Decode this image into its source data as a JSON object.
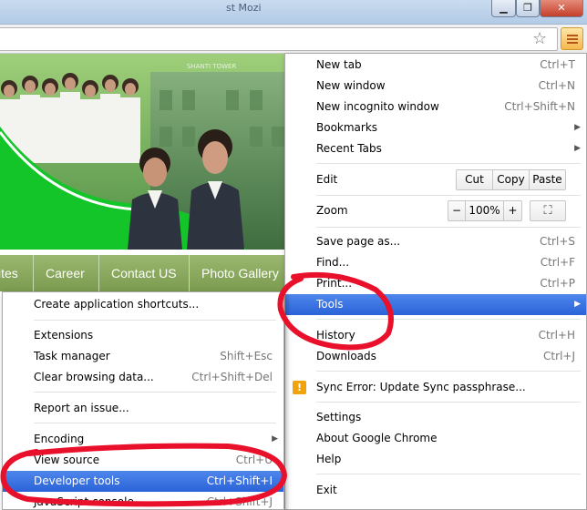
{
  "window": {
    "title": "st Mozi",
    "minimize_icon": "minimize-icon",
    "maximize_icon": "maximize-icon",
    "close_icon": "close-icon"
  },
  "toolbar": {
    "bookmark_icon": "star-icon",
    "menu_icon": "hamburger-menu-icon"
  },
  "page": {
    "building_sign": "SHANTI TOWER",
    "nav": [
      "ites",
      "Career",
      "Contact US",
      "Photo Gallery"
    ]
  },
  "main_menu": {
    "new_tab": {
      "label": "New tab",
      "shortcut": "Ctrl+T"
    },
    "new_window": {
      "label": "New window",
      "shortcut": "Ctrl+N"
    },
    "new_incognito": {
      "label": "New incognito window",
      "shortcut": "Ctrl+Shift+N"
    },
    "bookmarks": {
      "label": "Bookmarks"
    },
    "recent_tabs": {
      "label": "Recent Tabs"
    },
    "edit": {
      "label": "Edit",
      "cut": "Cut",
      "copy": "Copy",
      "paste": "Paste"
    },
    "zoom": {
      "label": "Zoom",
      "minus": "−",
      "level": "100%",
      "plus": "+"
    },
    "save_page": {
      "label": "Save page as...",
      "shortcut": "Ctrl+S"
    },
    "find": {
      "label": "Find...",
      "shortcut": "Ctrl+F"
    },
    "print": {
      "label": "Print...",
      "shortcut": "Ctrl+P"
    },
    "tools": {
      "label": "Tools"
    },
    "history": {
      "label": "History",
      "shortcut": "Ctrl+H"
    },
    "downloads": {
      "label": "Downloads",
      "shortcut": "Ctrl+J"
    },
    "sync_error": {
      "label": "Sync Error: Update Sync passphrase...",
      "icon": "warning-icon"
    },
    "settings": {
      "label": "Settings"
    },
    "about": {
      "label": "About Google Chrome"
    },
    "help": {
      "label": "Help"
    },
    "exit": {
      "label": "Exit"
    }
  },
  "tools_menu": {
    "create_shortcuts": {
      "label": "Create application shortcuts..."
    },
    "extensions": {
      "label": "Extensions"
    },
    "task_manager": {
      "label": "Task manager",
      "shortcut": "Shift+Esc"
    },
    "clear_browsing": {
      "label": "Clear browsing data...",
      "shortcut": "Ctrl+Shift+Del"
    },
    "report_issue": {
      "label": "Report an issue..."
    },
    "encoding": {
      "label": "Encoding"
    },
    "view_source": {
      "label": "View source",
      "shortcut": "Ctrl+U"
    },
    "developer_tools": {
      "label": "Developer tools",
      "shortcut": "Ctrl+Shift+I"
    },
    "javascript_console": {
      "label": "JavaScript console",
      "shortcut": "Ctrl+Shift+J"
    }
  },
  "colors": {
    "highlight": "#2a63d8",
    "annotation": "#e8102a",
    "banner_green": "#15c92b",
    "nav_olive": "#8aa95f"
  }
}
